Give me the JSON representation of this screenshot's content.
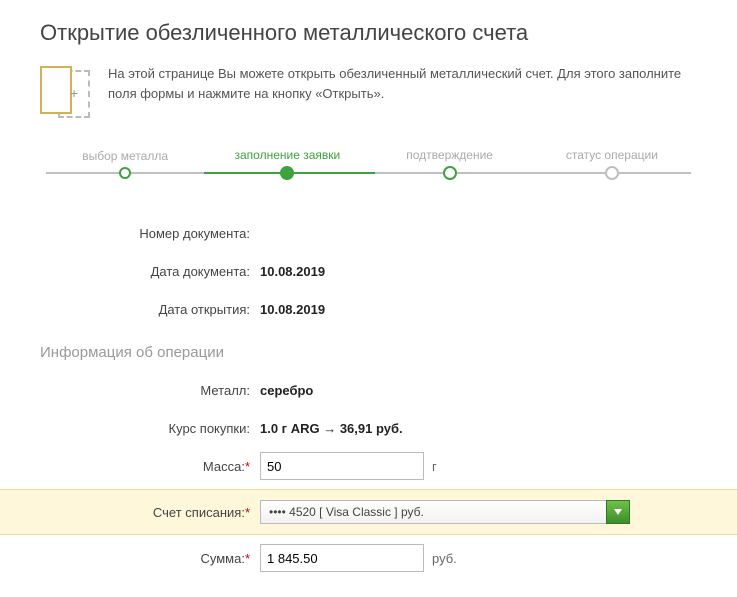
{
  "title": "Открытие обезличенного металлического счета",
  "intro": "На этой странице Вы можете открыть обезличенный металлический счет. Для этого заполните поля формы и нажмите на кнопку «Открыть».",
  "steps": {
    "s1": "выбор металла",
    "s2": "заполнение заявки",
    "s3": "подтверждение",
    "s4": "статус операции"
  },
  "labels": {
    "doc_number": "Номер документа:",
    "doc_date": "Дата документа:",
    "open_date": "Дата открытия:",
    "section": "Информация об операции",
    "metal": "Металл:",
    "rate": "Курс покупки:",
    "mass": "Масса:",
    "debit_account": "Счет списания:",
    "amount": "Сумма:"
  },
  "values": {
    "doc_number": "",
    "doc_date": "10.08.2019",
    "open_date": "10.08.2019",
    "metal": "серебро",
    "rate": "1.0 г  ARG → 36,91  руб.",
    "mass": "50",
    "mass_unit": "г",
    "debit_account": "•••• 4520   [ Visa Classic ]                            руб.",
    "amount": "1 845.50",
    "amount_unit": "руб."
  }
}
